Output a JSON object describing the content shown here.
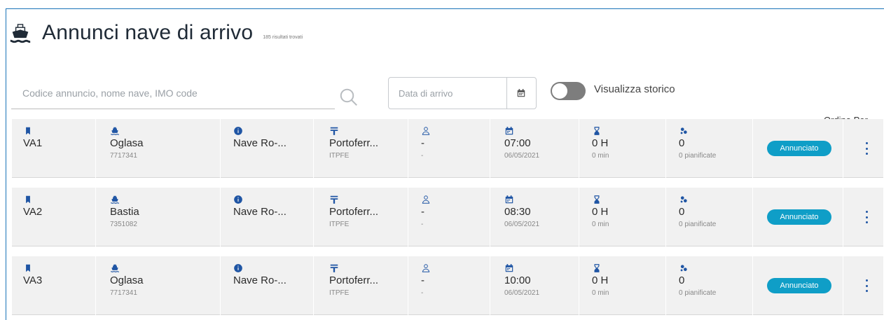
{
  "header": {
    "title": "Annunci nave di arrivo",
    "subtitle": "185 risultati trovati"
  },
  "filters": {
    "search_placeholder": "Codice annuncio, nome nave, IMO code",
    "date_placeholder": "Data di arrivo",
    "toggle_label": "Visualizza storico",
    "toggle_on": false,
    "sort_label": "Ordina Per"
  },
  "icons": {
    "code": "bookmark-icon",
    "ship": "ship-icon",
    "type": "info-icon",
    "port": "port-icon",
    "agent": "person-icon",
    "date": "calendar-icon",
    "duration": "hourglass-icon",
    "operations": "operations-icon"
  },
  "colors": {
    "accent": "#1f55a4",
    "badge": "#0f9ec7",
    "row_bg": "#f1f1f1",
    "frame": "#1a73b8"
  },
  "rows": [
    {
      "code": "VA1",
      "ship_name": "Oglasa",
      "imo": "7717341",
      "ship_type": "Nave Ro-...",
      "port": "Portoferr...",
      "port_code": "ITPFE",
      "agent": "-",
      "agent_sub": "-",
      "time": "07:00",
      "date": "06/05/2021",
      "duration_h": "0 H",
      "duration_min": "0 min",
      "operations": "0",
      "operations_sub": "0 pianificate",
      "status": "Annunciato"
    },
    {
      "code": "VA2",
      "ship_name": "Bastia",
      "imo": "7351082",
      "ship_type": "Nave Ro-...",
      "port": "Portoferr...",
      "port_code": "ITPFE",
      "agent": "-",
      "agent_sub": "-",
      "time": "08:30",
      "date": "06/05/2021",
      "duration_h": "0 H",
      "duration_min": "0 min",
      "operations": "0",
      "operations_sub": "0 pianificate",
      "status": "Annunciato"
    },
    {
      "code": "VA3",
      "ship_name": "Oglasa",
      "imo": "7717341",
      "ship_type": "Nave Ro-...",
      "port": "Portoferr...",
      "port_code": "ITPFE",
      "agent": "-",
      "agent_sub": "-",
      "time": "10:00",
      "date": "06/05/2021",
      "duration_h": "0 H",
      "duration_min": "0 min",
      "operations": "0",
      "operations_sub": "0 pianificate",
      "status": "Annunciato"
    }
  ]
}
